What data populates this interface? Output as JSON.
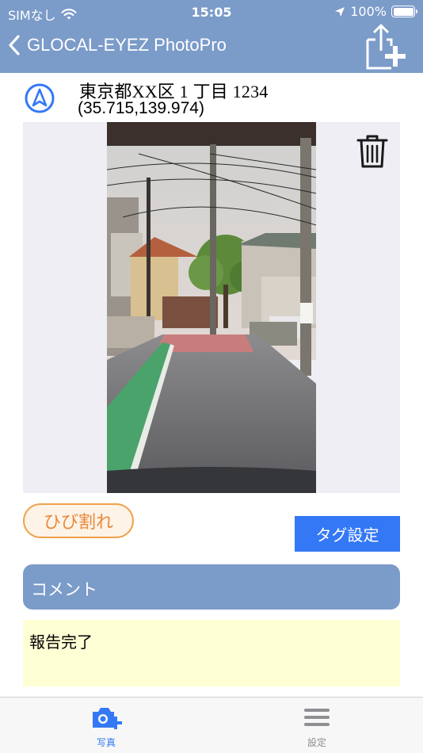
{
  "status_bar": {
    "carrier": "SIMなし",
    "time": "15:05",
    "battery": "100%",
    "battery_level": 1.0
  },
  "nav": {
    "back_icon": "chevron-left-icon",
    "title": "GLOCAL-EYEZ PhotoPro",
    "share_icon": "share-add-icon"
  },
  "location": {
    "address": "東京都XX区 1 丁目 1234",
    "coords": "(35.715,139.974)",
    "icon": "location-arrow-icon"
  },
  "photo": {
    "alt": "street-photo",
    "delete_icon": "trash-icon"
  },
  "tags": {
    "chip_label": "ひび割れ",
    "set_button": "タグ設定"
  },
  "comment": {
    "header": "コメント",
    "value": "報告完了"
  },
  "tabbar": {
    "tabs": [
      {
        "label": "写真",
        "icon": "camera-add-icon",
        "active": true
      },
      {
        "label": "設定",
        "icon": "menu-icon",
        "active": false
      }
    ]
  },
  "colors": {
    "header_bg": "#7b9bc9",
    "accent": "#3478f6",
    "tag_orange": "#f0a04b",
    "comment_bg": "#ffffd6"
  }
}
